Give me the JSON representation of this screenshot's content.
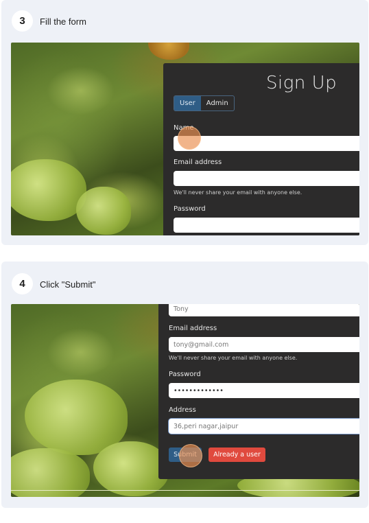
{
  "steps": [
    {
      "number": "3",
      "instruction": "Fill the form",
      "form": {
        "title": "Sign Up",
        "role_toggle": {
          "user": "User",
          "admin": "Admin",
          "selected": "User"
        },
        "name_label": "Name",
        "name_value": "",
        "email_label": "Email address",
        "email_value": "",
        "email_help": "We'll never share your email with anyone else.",
        "password_label": "Password",
        "password_value": ""
      }
    },
    {
      "number": "4",
      "instruction": "Click \"Submit\"",
      "form": {
        "name_value": "Tony",
        "email_label": "Email address",
        "email_value": "tony@gmail.com",
        "email_help": "We'll never share your email with anyone else.",
        "password_label": "Password",
        "password_value": "•••••••••••••",
        "address_label": "Address",
        "address_value": "36,peri nagar,jaipur",
        "submit_label": "Submit",
        "already_label": "Already a user"
      }
    }
  ],
  "colors": {
    "card_bg": "#eef1f7",
    "panel_bg": "#2c2b2b",
    "primary_button": "#2f5d86",
    "danger_button": "#e04a3e",
    "click_indicator": "#ea9052"
  }
}
